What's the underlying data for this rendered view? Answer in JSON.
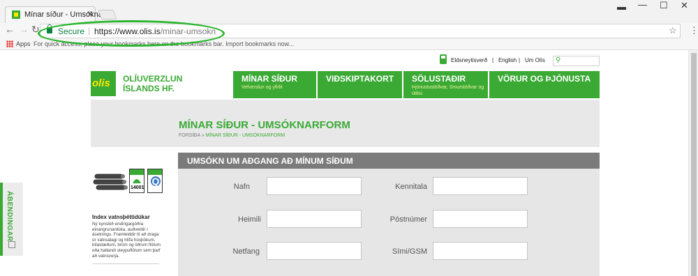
{
  "browser": {
    "tab_title": "Mínar síður - Umsóknar",
    "secure_label": "Secure",
    "url_host": "https://www.olis.is",
    "url_path": "/minar-umsokn",
    "apps_label": "Apps",
    "bookmarks_hint": "For quick access, place your bookmarks here on the bookmarks bar. Import bookmarks now..."
  },
  "topbar": {
    "fuel_price": "Eldsneytisverð",
    "english": "English",
    "about": "Um Olís",
    "separator": "|"
  },
  "logo": {
    "mark": "olis",
    "line1": "OLÍUVERZLUN",
    "line2": "ÍSLANDS HF."
  },
  "nav": [
    {
      "main": "MÍNAR SÍÐUR",
      "sub": "Vefverslun og yfirlit"
    },
    {
      "main": "VIÐSKIPTAKORT",
      "sub": ""
    },
    {
      "main": "SÖLUSTAÐIR",
      "sub": "Þjónustustöðvar, Smurstöðvar og útibú"
    },
    {
      "main": "VÖRUR OG ÞJÓNUSTA",
      "sub": ""
    }
  ],
  "hero": {
    "title": "MÍNAR SÍÐUR - UMSÓKNARFORM",
    "crumb_home": "FORSÍÐA",
    "crumb_sep": "»",
    "crumb_current": "MÍNAR SÍÐUR - UMSÓKNARFORM"
  },
  "form": {
    "heading": "UMSÓKN UM AÐGANG AÐ MÍNUM SÍÐUM",
    "fields": [
      "Nafn",
      "Kennitala",
      "Heimili",
      "Póstnúmer",
      "Netfang",
      "Sími/GSM"
    ]
  },
  "side": {
    "title": "Index vatnsþéttidúkar",
    "text": "Ný kynslóð endingargóðra einangrunardúka, auðveldir í ásetningu. Framleiddir til að draga úr vatnsálagi og hlífa húsþökum, bílastæðum, brúm og öðrum flötum eða hallandi steypuflötum sem þarf að vatnsverja.",
    "cert_mid": "14001"
  },
  "feedback": {
    "label": "ÁBENDINGAR"
  },
  "colors": {
    "brand_green": "#3aaa35",
    "logo_yellow": "#ffe600",
    "form_header": "#7b7b7b"
  }
}
